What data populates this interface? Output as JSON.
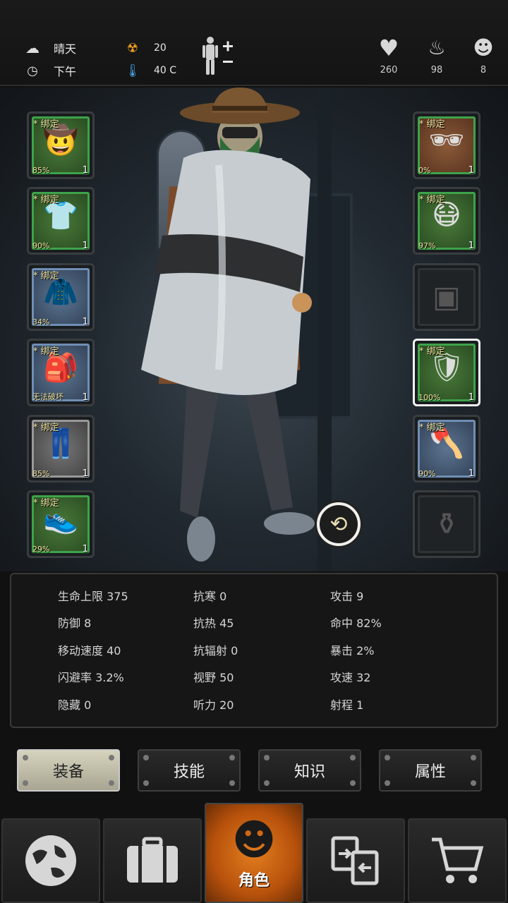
{
  "top": {
    "weather": "晴天",
    "time": "下午",
    "radiation": "20",
    "temperature": "40 C",
    "health": "260",
    "food": "98",
    "mind": "8"
  },
  "left_slots": [
    {
      "bind": "* 绑定",
      "pct": "85%",
      "count": "1",
      "item": "hat",
      "color": "green"
    },
    {
      "bind": "* 绑定",
      "pct": "90%",
      "count": "1",
      "item": "t-shirt",
      "color": "green"
    },
    {
      "bind": "* 绑定",
      "pct": "34%",
      "count": "1",
      "item": "coat",
      "color": "blue"
    },
    {
      "bind": "* 绑定",
      "pct": "无法破坏",
      "count": "1",
      "item": "backpack",
      "color": "blue"
    },
    {
      "bind": "* 绑定",
      "pct": "85%",
      "count": "1",
      "item": "pants",
      "color": "gray"
    },
    {
      "bind": "* 绑定",
      "pct": "29%",
      "count": "1",
      "item": "shoes",
      "color": "green"
    }
  ],
  "right_slots": [
    {
      "bind": "* 绑定",
      "pct": "0%",
      "count": "1",
      "item": "glasses",
      "color": "brown"
    },
    {
      "bind": "* 绑定",
      "pct": "97%",
      "count": "1",
      "item": "gas-mask",
      "color": "green"
    },
    {
      "bind": "",
      "pct": "",
      "count": "",
      "item": "vest-empty",
      "color": "empty"
    },
    {
      "bind": "* 绑定",
      "pct": "100%",
      "count": "1",
      "item": "riot-shield",
      "color": "green"
    },
    {
      "bind": "* 绑定",
      "pct": "90%",
      "count": "1",
      "item": "fire-axe",
      "color": "blue"
    },
    {
      "bind": "",
      "pct": "",
      "count": "",
      "item": "bottle-empty",
      "color": "empty"
    }
  ],
  "stats": [
    [
      "生命上限 375",
      "抗寒 0",
      "攻击 9"
    ],
    [
      "防御 8",
      "抗热 45",
      "命中 82%"
    ],
    [
      "移动速度 40",
      "抗辐射 0",
      "暴击 2%"
    ],
    [
      "闪避率 3.2%",
      "视野 50",
      "攻速 32"
    ],
    [
      "隐藏 0",
      "听力 20",
      "射程 1"
    ]
  ],
  "tabs": [
    "装备",
    "技能",
    "知识",
    "属性"
  ],
  "nav": {
    "active_label": "角色"
  }
}
